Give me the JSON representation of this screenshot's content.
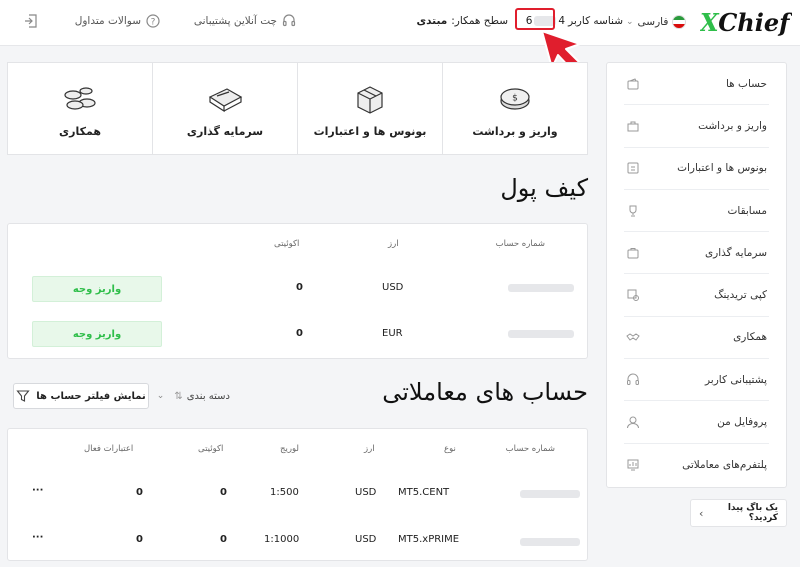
{
  "header": {
    "logo_text": "XChief",
    "language": "فارسی",
    "user_id_label": "شناسه کاربر",
    "user_id_start": "4",
    "user_id_end": "6",
    "partner_level_label": "سطح همکار:",
    "partner_level_value": "مبتدی",
    "support_chat": "چت آنلاین پشتیبانی",
    "faq": "سوالات متداول"
  },
  "cards": [
    {
      "label": "واریز و برداشت",
      "icon": "coin-icon"
    },
    {
      "label": "بونوس ها و اعتبارات",
      "icon": "gift-box-icon"
    },
    {
      "label": "سرمایه گذاری",
      "icon": "briefcase-icon"
    },
    {
      "label": "همکاری",
      "icon": "coins-stack-icon"
    }
  ],
  "sidebar": {
    "items": [
      {
        "label": "حساب ها",
        "icon": "wallet-icon"
      },
      {
        "label": "واریز و برداشت",
        "icon": "bank-icon"
      },
      {
        "label": "بونوس ها و اعتبارات",
        "icon": "bonus-icon"
      },
      {
        "label": "مسابقات",
        "icon": "trophy-icon"
      },
      {
        "label": "سرمایه گذاری",
        "icon": "briefcase-icon"
      },
      {
        "label": "کپی تریدینگ",
        "icon": "copy-icon"
      },
      {
        "label": "همکاری",
        "icon": "handshake-icon"
      },
      {
        "label": "پشتیبانی کاربر",
        "icon": "headset-icon"
      },
      {
        "label": "پروفایل من",
        "icon": "user-icon"
      },
      {
        "label": "پلتفرم‌های معاملاتی",
        "icon": "platform-icon"
      }
    ]
  },
  "bug_report": {
    "text": "یک باگ پیدا کردید؟"
  },
  "wallet": {
    "title": "کیف پول",
    "headers": {
      "account": "شماره حساب",
      "currency": "ارز",
      "equity": "اکوئیتی"
    },
    "rows": [
      {
        "currency": "USD",
        "equity": "0",
        "action": "واریز وجه"
      },
      {
        "currency": "EUR",
        "equity": "0",
        "action": "واریز وجه"
      }
    ]
  },
  "trading": {
    "title": "حساب های معاملاتی",
    "filter_button": "نمایش فیلتر حساب ها",
    "sort_label": "دسته بندی",
    "headers": {
      "account": "شماره حساب",
      "type": "نوع",
      "currency": "ارز",
      "leverage": "لوریج",
      "equity": "اکوئیتی",
      "credit": "اعتبارات فعال"
    },
    "rows": [
      {
        "type": "MT5.CENT",
        "currency": "USD",
        "leverage": "1:500",
        "equity": "0",
        "credit": "0",
        "more": "···"
      },
      {
        "type": "MT5.xPRIME",
        "currency": "USD",
        "leverage": "1:1000",
        "equity": "0",
        "credit": "0",
        "more": "···"
      }
    ]
  },
  "colors": {
    "accent_green": "#2fbe4a",
    "highlight_red": "#e01e2d"
  }
}
